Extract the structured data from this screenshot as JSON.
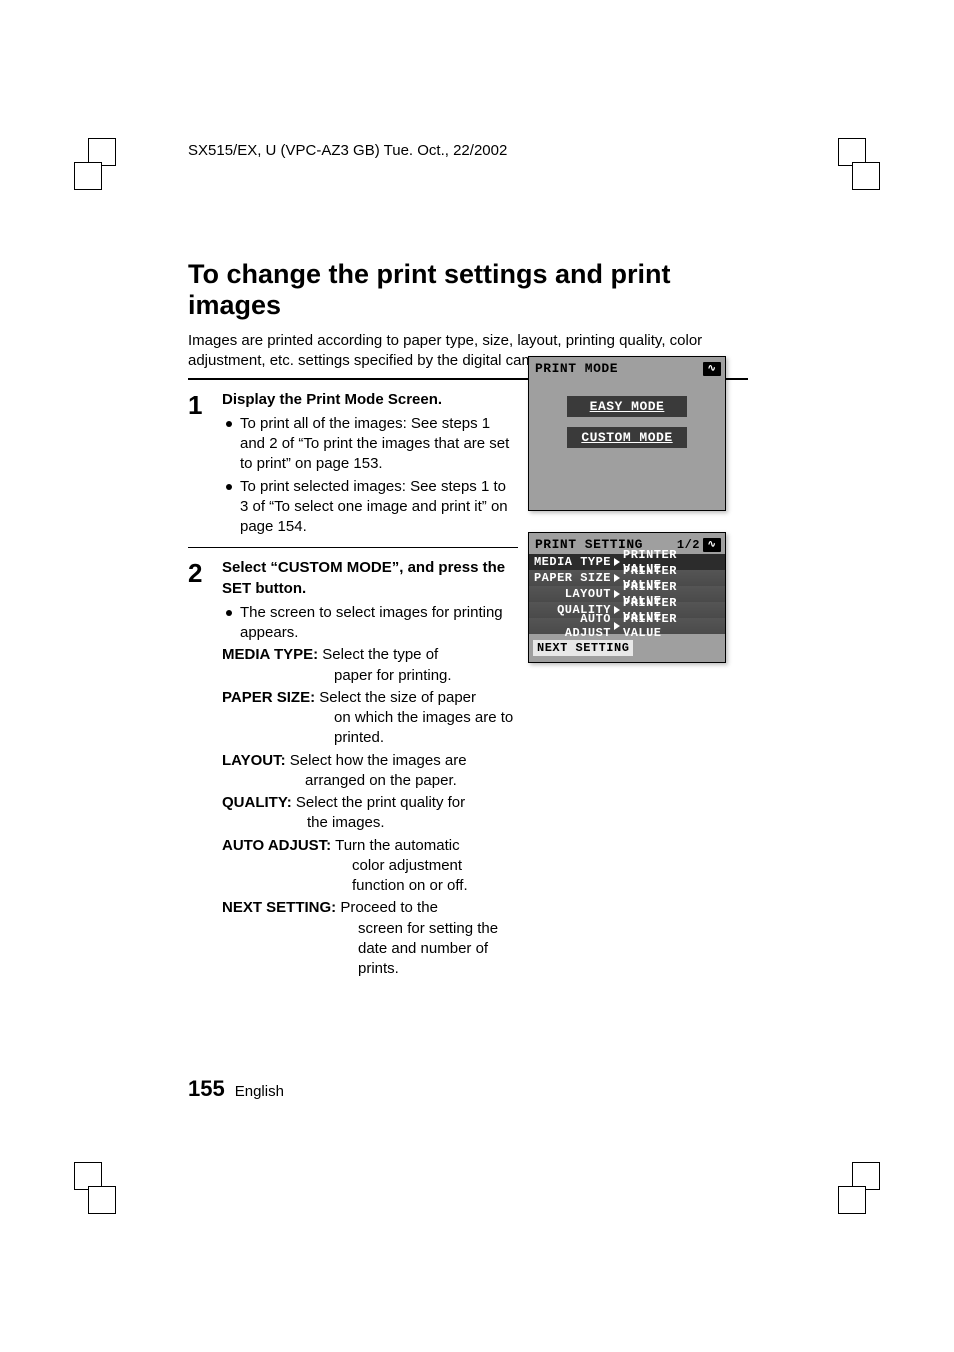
{
  "doc_header": "SX515/EX, U (VPC-AZ3 GB)    Tue. Oct., 22/2002",
  "h1": "To change the print settings and print images",
  "intro": "Images are printed according to paper type, size, layout, printing quality, color adjustment, etc. settings specified by the digital camera.",
  "step1": {
    "num": "1",
    "title": "Display the Print Mode Screen.",
    "b1": "To print all of the images: See steps 1 and 2 of “To print the images that are set to print” on page 153.",
    "b2": "To print selected images: See steps 1 to 3 of “To select one image and print it” on page 154."
  },
  "step2": {
    "num": "2",
    "title": "Select “CUSTOM MODE”, and press the SET button.",
    "b1": "The screen to select images for printing appears.",
    "defs": {
      "media_type": {
        "label": "MEDIA TYPE:",
        "text_first": " Select the type of",
        "text_rest": "paper for printing."
      },
      "paper_size": {
        "label": "PAPER SIZE:",
        "text_first": " Select the size of paper",
        "text_rest": "on which the images are to printed."
      },
      "layout": {
        "label": "LAYOUT:",
        "text_first": " Select how the images are",
        "text_rest": "arranged on the paper."
      },
      "quality": {
        "label": "QUALITY:",
        "text_first": " Select the print quality for",
        "text_rest": "the images."
      },
      "auto_adjust": {
        "label": "AUTO ADJUST:",
        "text_first": " Turn the automatic",
        "text_rest": "color adjustment function on or off."
      },
      "next_setting": {
        "label": "NEXT SETTING:",
        "text_first": " Proceed to the",
        "text_rest": "screen for setting the date and number of prints."
      }
    }
  },
  "lcd1": {
    "title": "PRINT MODE",
    "icon": "∿",
    "easy": "EASY  MODE",
    "custom": "CUSTOM MODE"
  },
  "lcd2": {
    "title": "PRINT SETTING",
    "page": "1/2",
    "icon": "∿",
    "rows": [
      {
        "label": "MEDIA TYPE",
        "value": "PRINTER VALUE"
      },
      {
        "label": "PAPER SIZE",
        "value": "PRINTER VALUE"
      },
      {
        "label": "LAYOUT",
        "value": "PRINTER VALUE"
      },
      {
        "label": "QUALITY",
        "value": "PRINTER VALUE"
      },
      {
        "label": "AUTO ADJUST",
        "value": "PRINTER VALUE"
      }
    ],
    "next": "NEXT SETTING"
  },
  "footer": {
    "page": "155",
    "lang": "English"
  }
}
